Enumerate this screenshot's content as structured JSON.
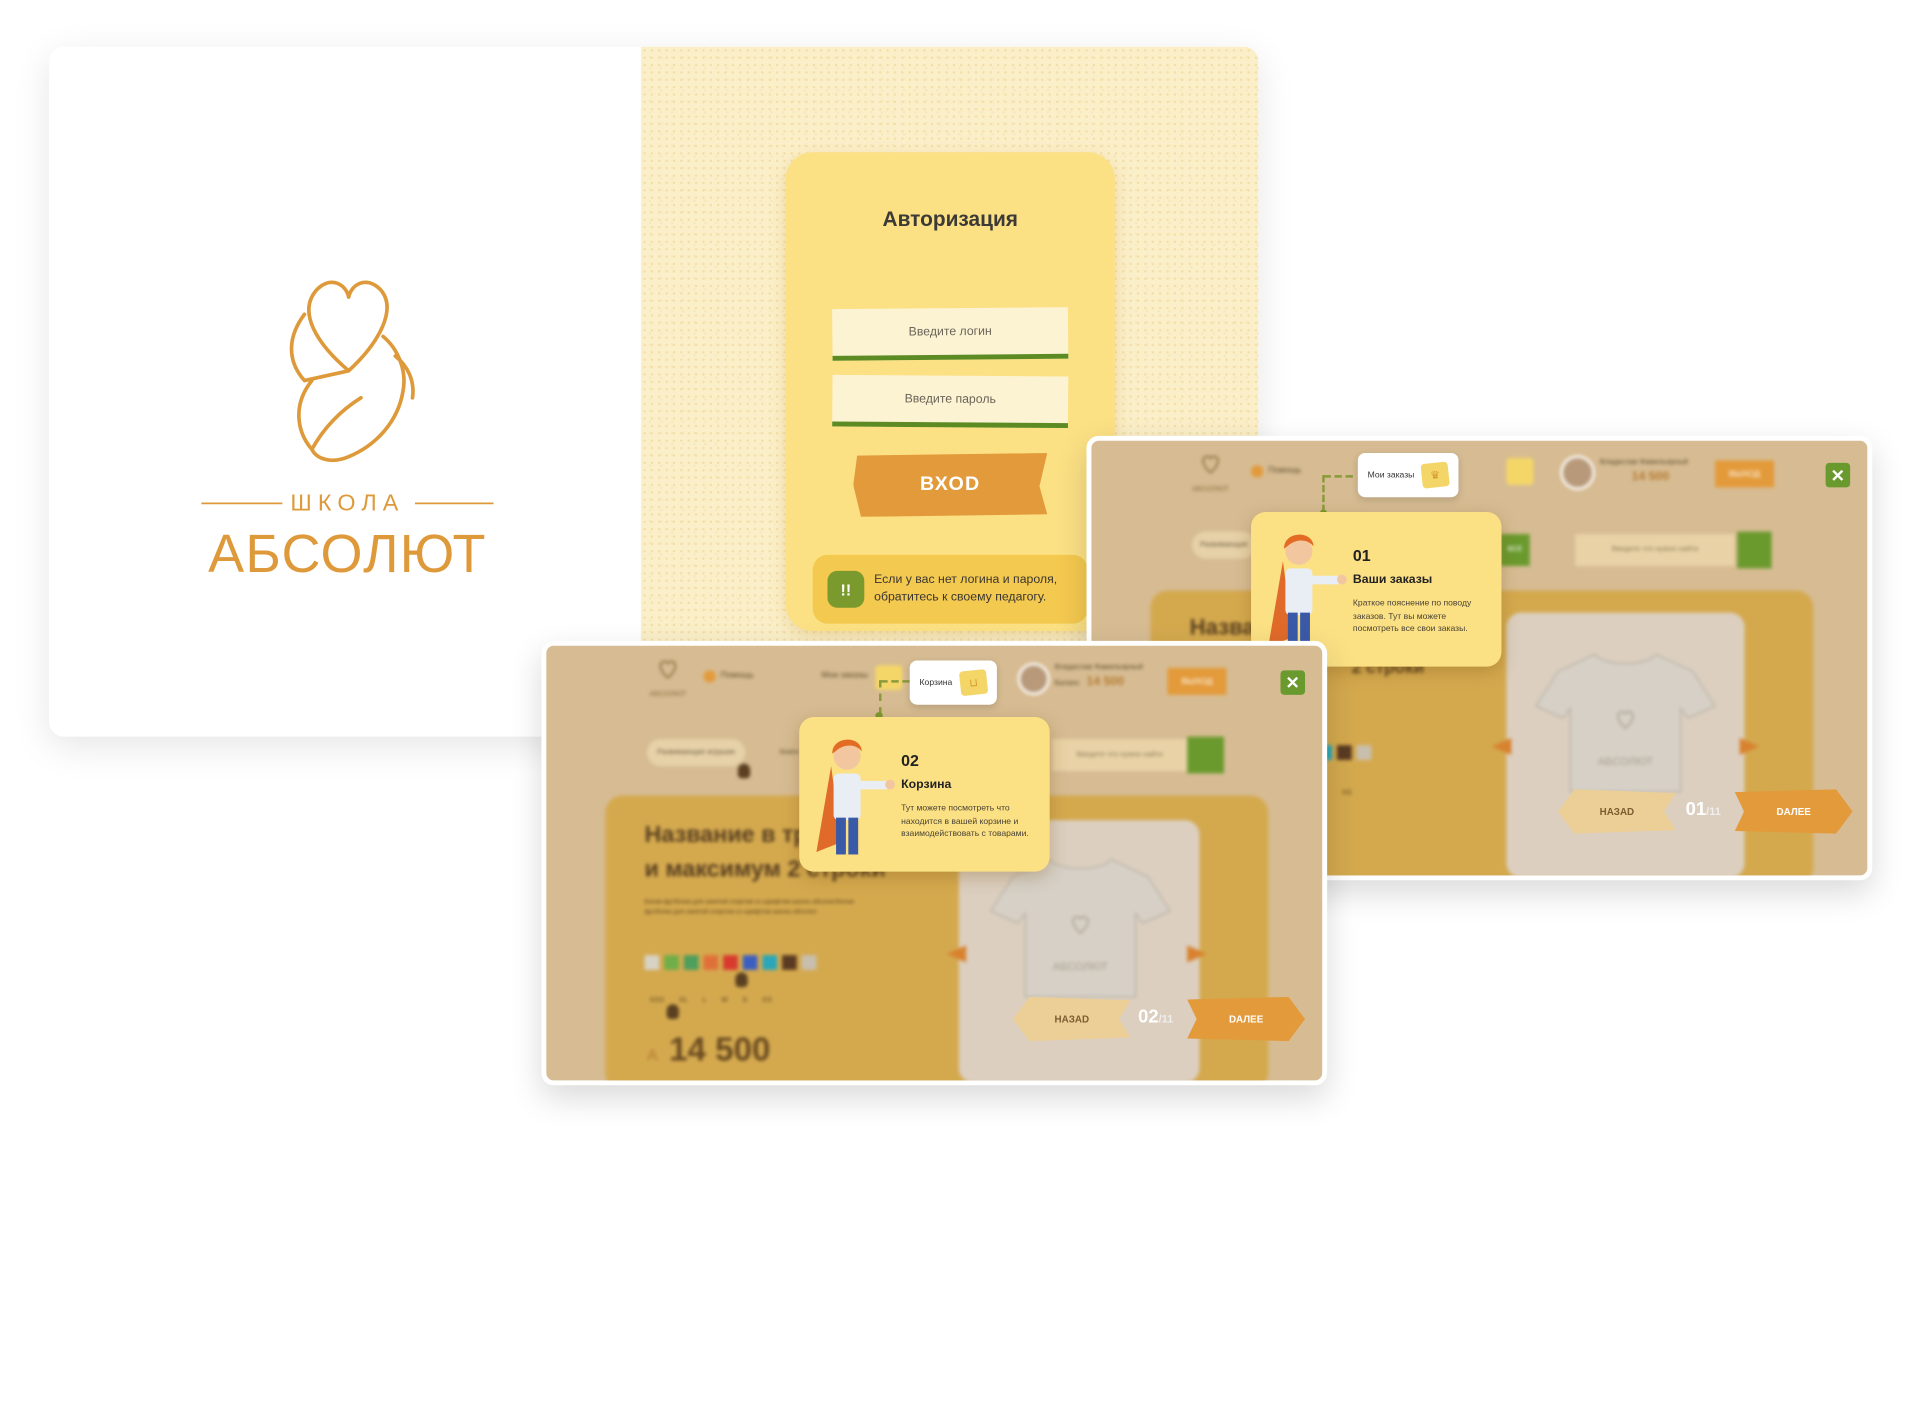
{
  "brand": {
    "school_label": "ШКОЛА",
    "name": "АБСОЛЮТ"
  },
  "auth": {
    "title": "Авторизация",
    "login_placeholder": "Введите логин",
    "password_placeholder": "Введите пароль",
    "submit_label": "ВХОD",
    "hint_icon": "!!",
    "hint_line1": "Если у вас нет логина и пароля,",
    "hint_line2": "обратитесь к своему педагогу."
  },
  "screen1": {
    "help_label": "Помощь",
    "user_name": "Владислав Фамильярный",
    "balance": "14 500",
    "exit_label": "ВЫХОД",
    "category_label": "Развивающие",
    "all_label": "ВСЕ",
    "search_placeholder": "Введите что нужно найти",
    "product_title_fragment": "Назва",
    "product_title_line2": "2 строки",
    "size_label": "XS",
    "tshirt_logo": "АБСОЛЮТ",
    "tour": {
      "chip_label": "Мои заказы",
      "step": "01",
      "title": "Ваши заказы",
      "text": "Краткое пояснение по поводу заказов. Тут вы можете посмотреть все свои заказы.",
      "back_label": "НАЗАD",
      "next_label": "DАЛЕЕ",
      "current": "01",
      "total": "/11",
      "close_label": "✕"
    }
  },
  "screen2": {
    "help_label": "Помощь",
    "orders_label": "Мои заказы",
    "user_name": "Владислав Фамильярный",
    "balance_label": "Баланс",
    "balance": "14 500",
    "exit_label": "ВЫХОД",
    "category_label": "Развивающие игрушки",
    "tab_label": "Книги",
    "search_placeholder": "Введите что нужно найти",
    "product_title_line1": "Название в тр",
    "product_title_line2": "и максимум 2 строки",
    "product_desc": "Белая футболка для занятий спортом со шрифтом школы абсолютБелая футболка для занятий спортом со шрифтом школы абсолют",
    "sizes": [
      "XXS",
      "XL",
      "L",
      "M",
      "S",
      "XS"
    ],
    "price_currency": "A",
    "price": "14 500",
    "tshirt_logo": "АБСОЛЮТ",
    "tour": {
      "chip_label": "Корзина",
      "step": "02",
      "title": "Корзина",
      "text": "Тут можете посмотреть что находится в вашей корзине и взаимодействовать с товарами.",
      "back_label": "НАЗАD",
      "next_label": "DАЛЕЕ",
      "current": "02",
      "total": "/11",
      "close_label": "✕"
    }
  },
  "colors": {
    "accent_orange": "#e39a3a",
    "accent_green": "#6a9a2e",
    "panel_yellow": "#fbe084",
    "swatches": [
      "#d8d2c4",
      "#6fae48",
      "#4e9e5c",
      "#e0703a",
      "#d83a2e",
      "#3b5fc0",
      "#2aa7b8",
      "#5a3a22",
      "#c9bfae"
    ]
  },
  "icons": [
    "heart-hand-logo-icon",
    "help-icon",
    "cart-icon",
    "crown-icon",
    "search-icon",
    "close-icon",
    "arrow-left-icon",
    "arrow-right-icon",
    "cursor-hand-icon"
  ]
}
